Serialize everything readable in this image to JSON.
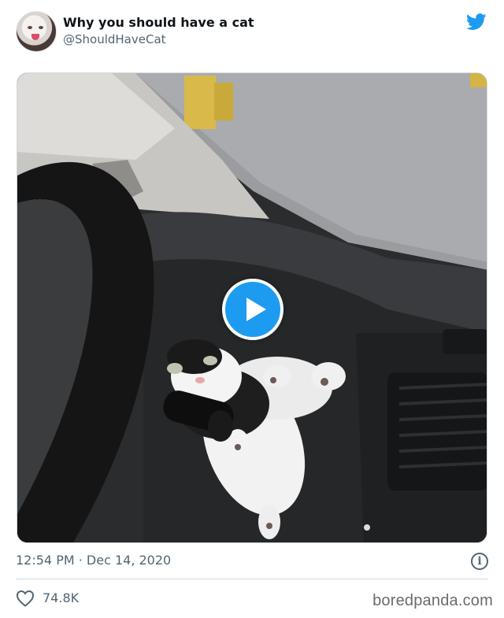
{
  "tweet": {
    "display_name": "Why you should have a cat",
    "handle": "@ShouldHaveCat",
    "timestamp": "12:54 PM · Dec 14, 2020",
    "likes": "74.8K",
    "info_glyph": "i"
  },
  "icons": {
    "brand": "twitter-bird-icon",
    "play": "play-icon",
    "info": "info-icon",
    "like": "heart-icon"
  },
  "colors": {
    "twitter_blue": "#1d9bf0",
    "secondary_text": "#536471",
    "primary_text": "#0f1419"
  },
  "watermark": "boredpanda.com"
}
